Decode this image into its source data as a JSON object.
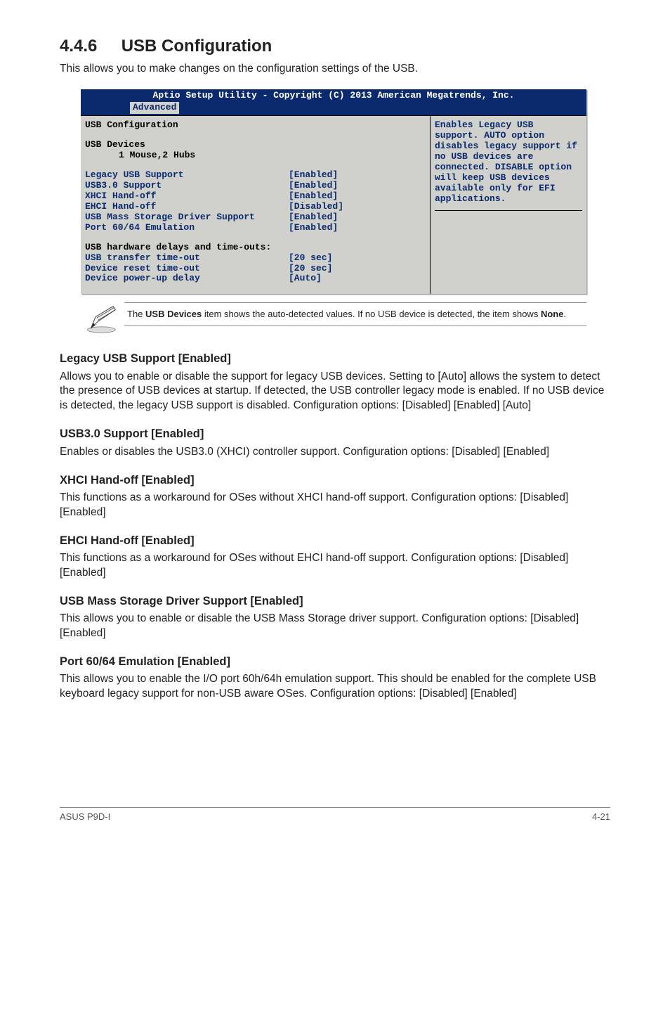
{
  "heading": {
    "num": "4.4.6",
    "title": "USB Configuration"
  },
  "intro": "This allows you to make changes on the configuration settings of the USB.",
  "bios": {
    "top": "Aptio Setup Utility - Copyright (C) 2013 American Megatrends, Inc.",
    "tab": "Advanced",
    "section_title": "USB Configuration",
    "devices_label": "USB Devices",
    "devices_value": "1 Mouse,2 Hubs",
    "opts": [
      {
        "label": "Legacy USB Support",
        "value": "[Enabled]"
      },
      {
        "label": "USB3.0 Support",
        "value": "[Enabled]"
      },
      {
        "label": "XHCI Hand-off",
        "value": "[Enabled]"
      },
      {
        "label": "EHCI Hand-off",
        "value": "[Disabled]"
      },
      {
        "label": "USB Mass Storage Driver Support",
        "value": "[Enabled]"
      },
      {
        "label": "Port 60/64 Emulation",
        "value": "[Enabled]"
      }
    ],
    "hw_title": "USB hardware delays and time-outs:",
    "hw": [
      {
        "label": "USB transfer time-out",
        "value": "[20 sec]"
      },
      {
        "label": "Device reset time-out",
        "value": "[20 sec]"
      },
      {
        "label": "Device power-up delay",
        "value": "[Auto]"
      }
    ],
    "help": "Enables Legacy USB support. AUTO option disables legacy support if no USB devices are connected. DISABLE option will keep USB devices available only for EFI applications."
  },
  "note": {
    "pre": "The ",
    "bold1": "USB Devices",
    "mid": " item shows the auto-detected values. If no USB device is detected, the item shows ",
    "bold2": "None",
    "post": "."
  },
  "sections": [
    {
      "title": "Legacy USB Support [Enabled]",
      "body": "Allows you to enable or disable the support for legacy USB devices. Setting to [Auto] allows the system to detect the presence of USB devices at startup. If detected, the USB controller legacy mode is enabled. If no USB device is detected, the legacy USB support is disabled. Configuration options: [Disabled] [Enabled] [Auto]"
    },
    {
      "title": "USB3.0 Support [Enabled]",
      "body": "Enables or disables the USB3.0 (XHCI) controller support. Configuration options: [Disabled] [Enabled]"
    },
    {
      "title": "XHCI Hand-off [Enabled]",
      "body": "This functions as a workaround for OSes without XHCI hand-off support. Configuration options: [Disabled] [Enabled]"
    },
    {
      "title": "EHCI Hand-off [Enabled]",
      "body": "This functions as a workaround for OSes without EHCI hand-off support. Configuration options: [Disabled] [Enabled]"
    },
    {
      "title": "USB Mass Storage Driver Support [Enabled]",
      "body": "This allows you to enable or disable the USB Mass Storage driver support. Configuration options: [Disabled] [Enabled]"
    },
    {
      "title": "Port 60/64 Emulation [Enabled]",
      "body": "This allows you to enable the I/O port 60h/64h emulation support. This should be enabled for the complete USB keyboard legacy support for non-USB aware OSes. Configuration options: [Disabled] [Enabled]"
    }
  ],
  "footer": {
    "left": "ASUS P9D-I",
    "right": "4-21"
  }
}
